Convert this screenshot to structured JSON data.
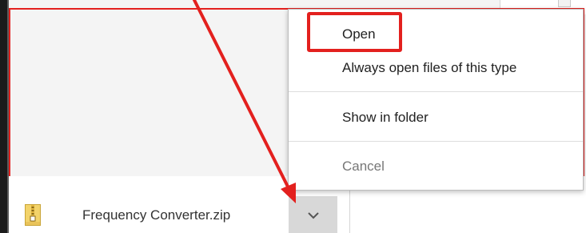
{
  "download": {
    "file_name": "Frequency Converter.zip",
    "file_icon": "zip-archive-icon",
    "options_icon": "chevron-down-icon"
  },
  "context_menu": {
    "items": [
      {
        "label": "Open",
        "enabled": true
      },
      {
        "label": "Always open files of this type",
        "enabled": true
      },
      {
        "label": "Show in folder",
        "enabled": true
      },
      {
        "label": "Cancel",
        "enabled": false
      }
    ]
  },
  "annotation": {
    "highlight_color": "#e3201e",
    "highlighted_item": "Open"
  },
  "colors": {
    "menu_background": "#ffffff",
    "chevron_button_background": "#d8d8d8",
    "disabled_text": "#777777"
  }
}
